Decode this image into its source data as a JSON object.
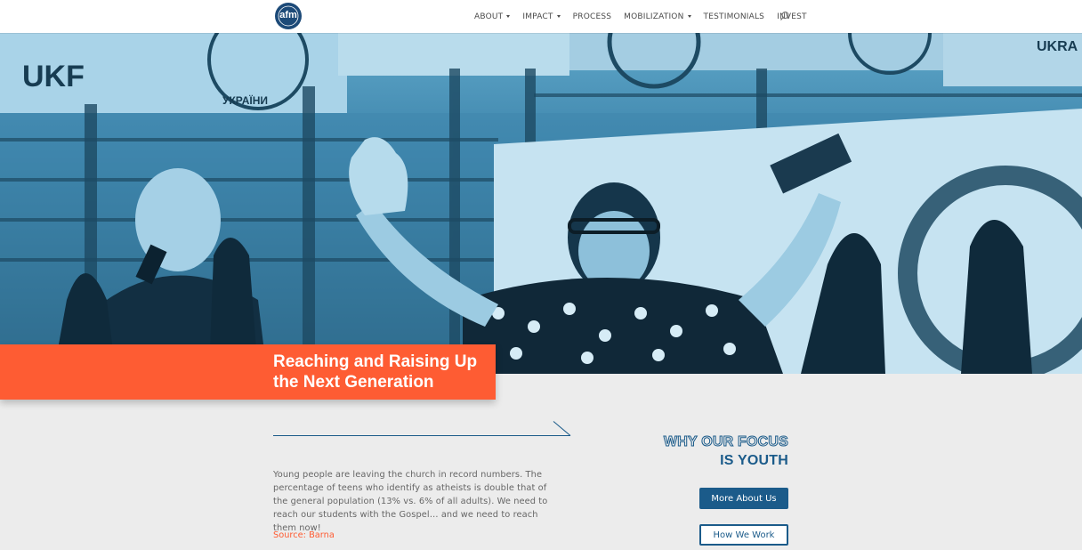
{
  "header": {
    "logo_text": "afm",
    "nav": [
      {
        "label": "ABOUT",
        "has_dropdown": true
      },
      {
        "label": "IMPACT",
        "has_dropdown": true
      },
      {
        "label": "PROCESS",
        "has_dropdown": false
      },
      {
        "label": "MOBILIZATION",
        "has_dropdown": true
      },
      {
        "label": "TESTIMONIALS",
        "has_dropdown": false
      },
      {
        "label": "INVEST",
        "has_dropdown": false
      }
    ],
    "search_icon": "search-icon"
  },
  "hero": {
    "caption_line1": "Reaching and Raising Up",
    "caption_line2": "the Next Generation",
    "banner_texts": [
      "UKF",
      "УКРАЇНИ",
      "UKRA"
    ],
    "caption_color": "#fe5c33"
  },
  "content": {
    "body": "Young people are leaving the church in record numbers. The percentage of teens who identify as atheists is double that of the general population (13% vs. 6% of all adults). We need to reach our students with the Gospel… and we need to reach them now!",
    "source": "Source: Barna",
    "focus_line1": "WHY OUR FOCUS",
    "focus_line2": "IS YOUTH",
    "button_primary": "More About Us",
    "button_secondary": "How We Work",
    "accent_color": "#1b5b8a"
  }
}
